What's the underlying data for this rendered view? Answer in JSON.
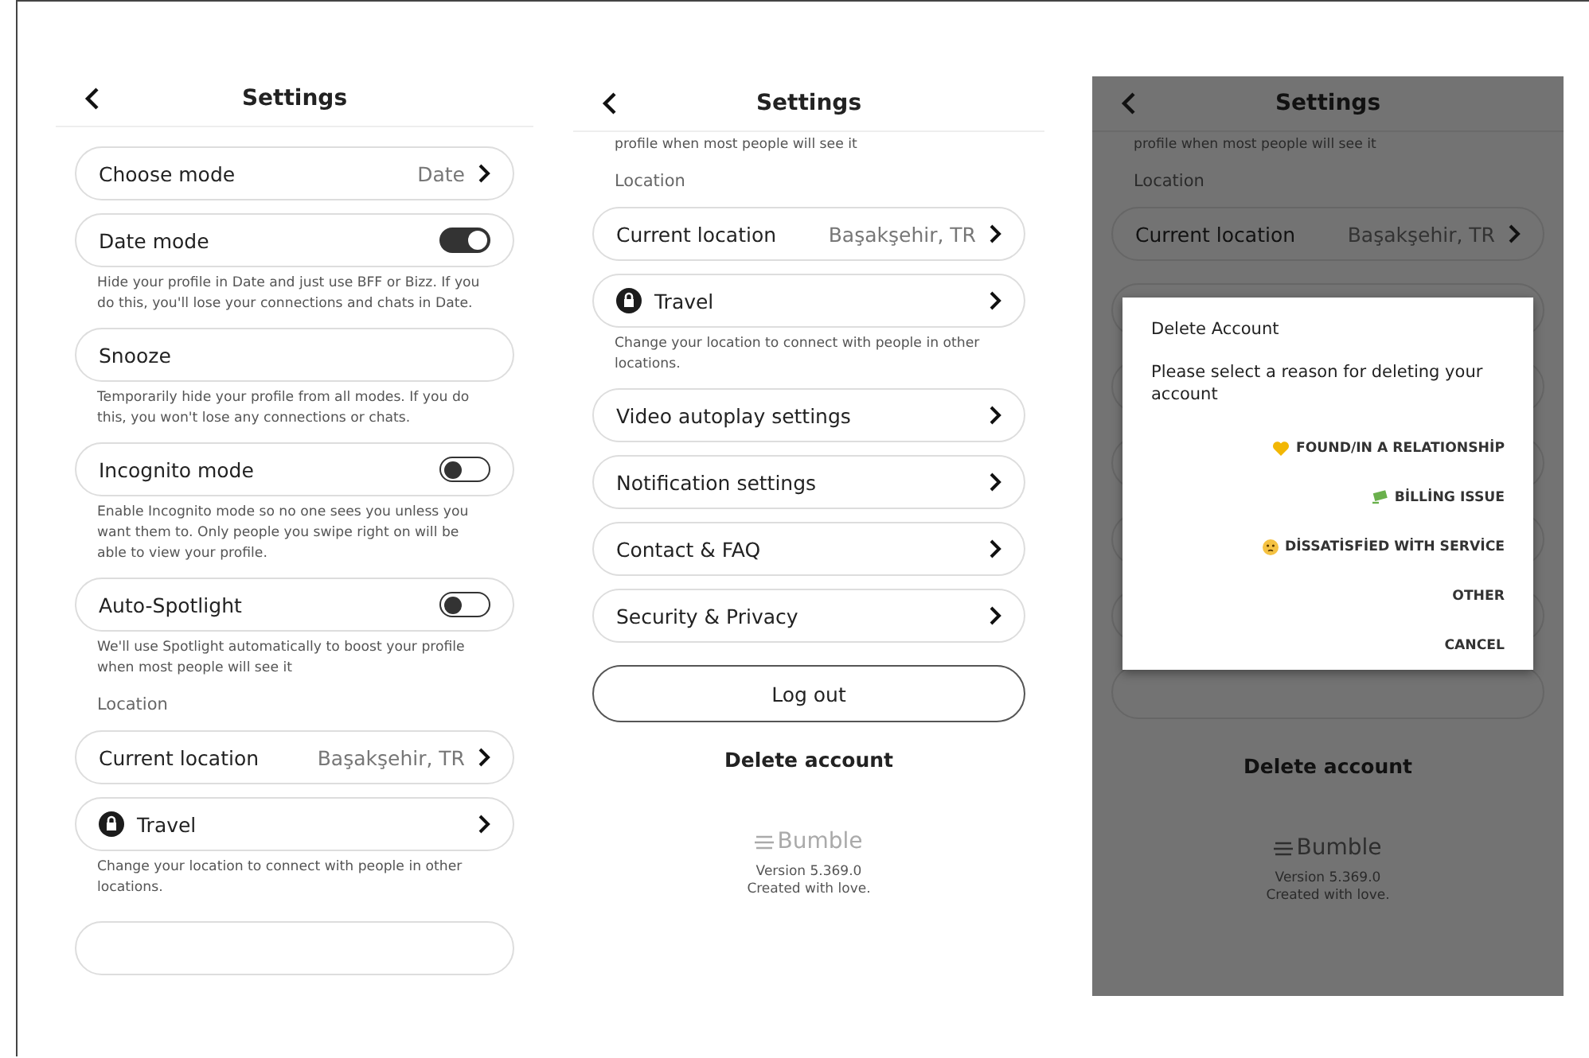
{
  "screens": [
    {
      "title": "Settings",
      "dimmed": false,
      "items": [
        {
          "kind": "nav",
          "label": "Choose mode",
          "value": "Date"
        },
        {
          "kind": "toggle",
          "label": "Date mode",
          "on": true
        },
        {
          "kind": "note",
          "text": "Hide your profile in Date and just use BFF or Bizz. If you do this, you'll lose your connections and chats in Date."
        },
        {
          "kind": "plain",
          "label": "Snooze"
        },
        {
          "kind": "note",
          "text": "Temporarily hide your profile from all modes. If you do this, you won't lose any connections or chats."
        },
        {
          "kind": "toggle",
          "label": "Incognito mode",
          "on": false
        },
        {
          "kind": "note",
          "text": "Enable Incognito mode so no one sees you unless you want them to. Only people you swipe right on will be able to view your profile."
        },
        {
          "kind": "toggle",
          "label": "Auto-Spotlight",
          "on": false
        },
        {
          "kind": "note",
          "text": "We'll use Spotlight automatically to boost your profile when most people will see it"
        },
        {
          "kind": "section",
          "text": "Location"
        },
        {
          "kind": "nav",
          "label": "Current location",
          "value": "Başakşehir, TR"
        },
        {
          "kind": "lock",
          "label": "Travel"
        },
        {
          "kind": "note",
          "text": "Change your location to connect with people in other locations."
        },
        {
          "kind": "blank"
        }
      ]
    },
    {
      "title": "Settings",
      "dimmed": false,
      "items": [
        {
          "kind": "note",
          "text": "profile when most people will see it"
        },
        {
          "kind": "section",
          "text": "Location"
        },
        {
          "kind": "nav",
          "label": "Current location",
          "value": "Başakşehir, TR"
        },
        {
          "kind": "lock",
          "label": "Travel"
        },
        {
          "kind": "note",
          "text": "Change your location to connect with people in other locations."
        },
        {
          "kind": "nav",
          "label": "Video autoplay settings"
        },
        {
          "kind": "nav",
          "label": "Notification settings"
        },
        {
          "kind": "nav",
          "label": "Contact & FAQ"
        },
        {
          "kind": "nav",
          "label": "Security & Privacy"
        },
        {
          "kind": "button",
          "label": "Log out"
        },
        {
          "kind": "link",
          "label": "Delete account"
        },
        {
          "kind": "footer",
          "brand": "Bumble",
          "lines": [
            "Version 5.369.0",
            "Created with love."
          ]
        }
      ]
    },
    {
      "title": "Settings",
      "dimmed": true,
      "items": [
        {
          "kind": "note",
          "text": "profile when most people will see it"
        },
        {
          "kind": "section",
          "text": "Location"
        },
        {
          "kind": "nav",
          "label": "Current location",
          "value": "Başakşehir, TR"
        },
        {
          "kind": "blank"
        },
        {
          "kind": "blank"
        },
        {
          "kind": "blank"
        },
        {
          "kind": "blank"
        },
        {
          "kind": "blank"
        },
        {
          "kind": "blank"
        },
        {
          "kind": "link",
          "label": "Delete account"
        },
        {
          "kind": "footer",
          "brand": "Bumble",
          "lines": [
            "Version 5.369.0",
            "Created with love."
          ]
        }
      ],
      "dialog": {
        "title": "Delete Account",
        "message": "Please select a reason for deleting your account",
        "options": [
          {
            "kind": "heart",
            "label": "FOUND/IN A RELATIONSHİP"
          },
          {
            "kind": "money",
            "label": "BİLLİNG ISSUE"
          },
          {
            "kind": "face",
            "label": "DİSSATİSFİED WİTH SERVİCE"
          },
          {
            "kind": "plain",
            "label": "OTHER"
          },
          {
            "kind": "plain",
            "label": "CANCEL"
          }
        ]
      }
    }
  ]
}
